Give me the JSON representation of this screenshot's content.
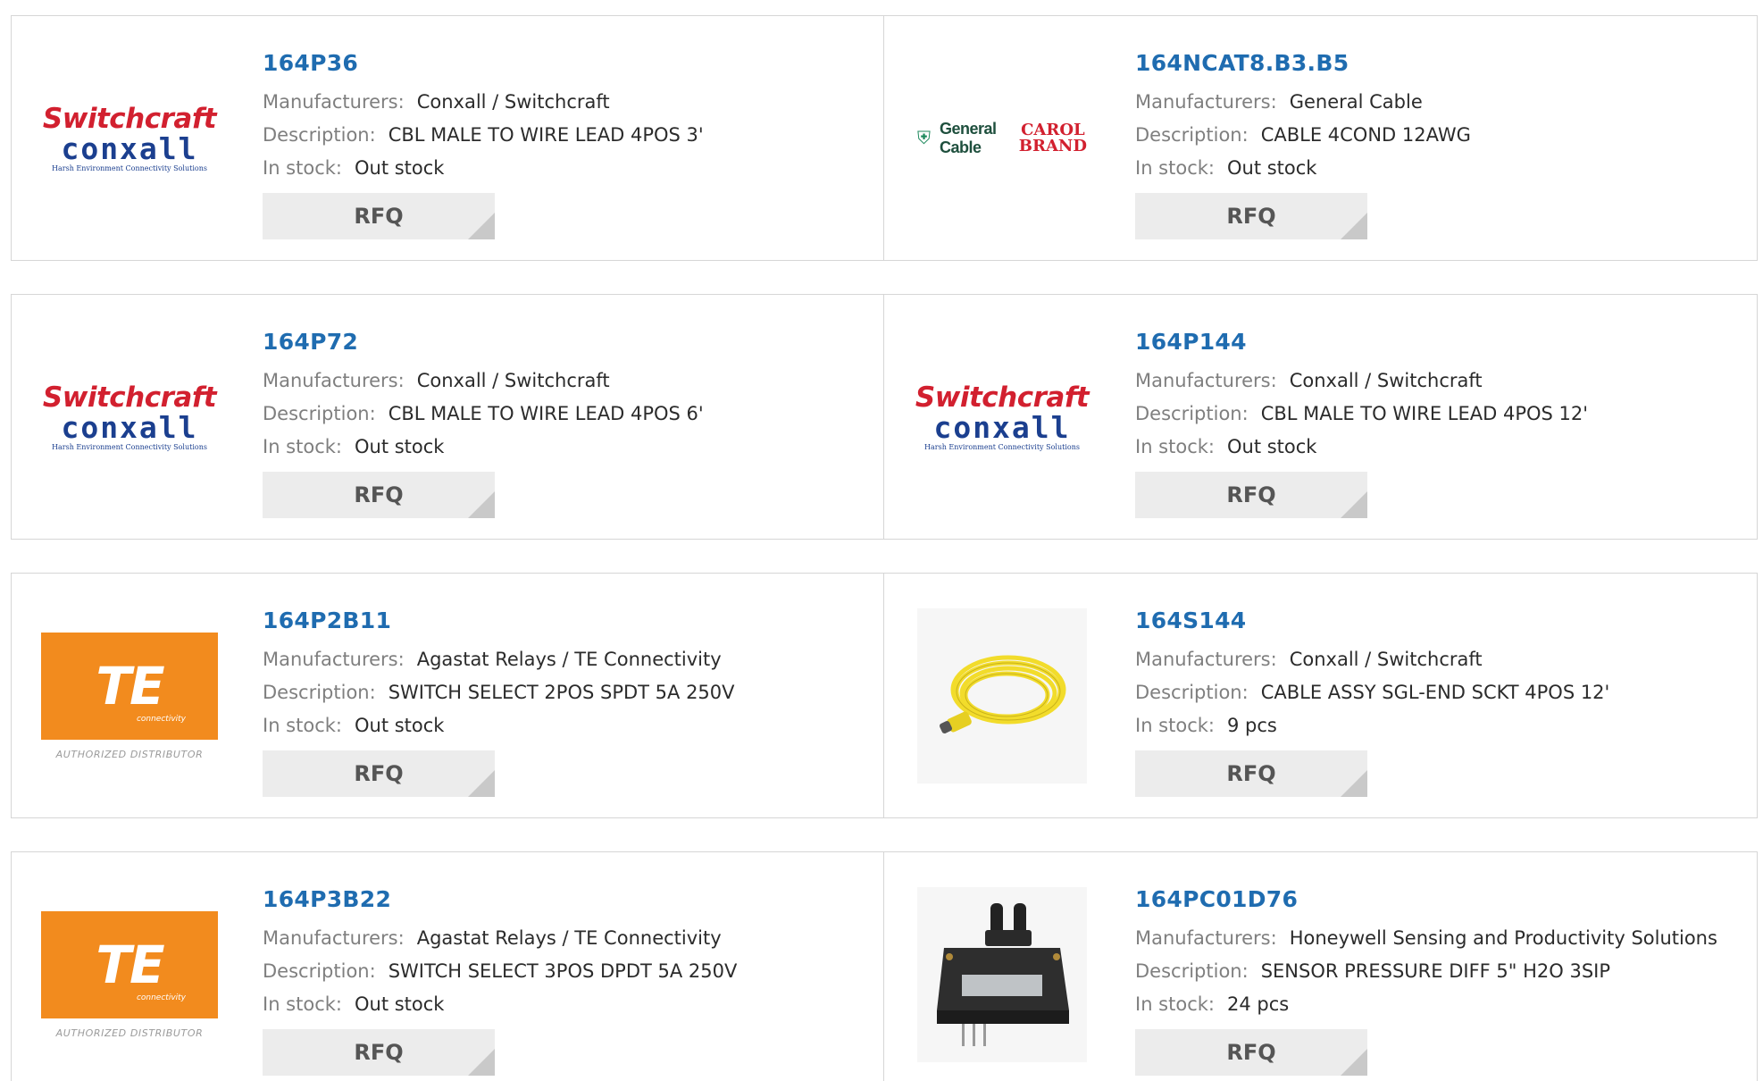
{
  "products": [
    {
      "part_number": "164P36",
      "manufacturer_label": "Manufacturers:",
      "manufacturer": "Conxall / Switchcraft",
      "description_label": "Description:",
      "description": "CBL MALE TO WIRE LEAD 4POS 3'",
      "stock_label": "In stock:",
      "stock": "Out stock",
      "rfq_label": "RFQ",
      "logo": {
        "line1": "Switchcraft",
        "line2": "conxall",
        "line3": "Harsh Environment Connectivity Solutions"
      }
    },
    {
      "part_number": "164NCAT8.B3.B5",
      "manufacturer_label": "Manufacturers:",
      "manufacturer": "General Cable",
      "description_label": "Description:",
      "description": "CABLE 4COND 12AWG",
      "stock_label": "In stock:",
      "stock": "Out stock",
      "rfq_label": "RFQ",
      "logo": {
        "line1": "General Cable",
        "line2": "CAROL",
        "line3": "BRAND"
      }
    },
    {
      "part_number": "164P72",
      "manufacturer_label": "Manufacturers:",
      "manufacturer": "Conxall / Switchcraft",
      "description_label": "Description:",
      "description": "CBL MALE TO WIRE LEAD 4POS 6'",
      "stock_label": "In stock:",
      "stock": "Out stock",
      "rfq_label": "RFQ",
      "logo": {
        "line1": "Switchcraft",
        "line2": "conxall",
        "line3": "Harsh Environment Connectivity Solutions"
      }
    },
    {
      "part_number": "164P144",
      "manufacturer_label": "Manufacturers:",
      "manufacturer": "Conxall / Switchcraft",
      "description_label": "Description:",
      "description": "CBL MALE TO WIRE LEAD 4POS 12'",
      "stock_label": "In stock:",
      "stock": "Out stock",
      "rfq_label": "RFQ",
      "logo": {
        "line1": "Switchcraft",
        "line2": "conxall",
        "line3": "Harsh Environment Connectivity Solutions"
      }
    },
    {
      "part_number": "164P2B11",
      "manufacturer_label": "Manufacturers:",
      "manufacturer": "Agastat Relays / TE Connectivity",
      "description_label": "Description:",
      "description": "SWITCH SELECT 2POS SPDT 5A 250V",
      "stock_label": "In stock:",
      "stock": "Out stock",
      "rfq_label": "RFQ",
      "logo": {
        "line1": "TE",
        "line2": "connectivity",
        "line3": "AUTHORIZED DISTRIBUTOR"
      }
    },
    {
      "part_number": "164S144",
      "manufacturer_label": "Manufacturers:",
      "manufacturer": "Conxall / Switchcraft",
      "description_label": "Description:",
      "description": "CABLE ASSY SGL-END SCKT 4POS 12'",
      "stock_label": "In stock:",
      "stock": "9 pcs",
      "rfq_label": "RFQ",
      "logo": {
        "line1": "",
        "line2": "",
        "line3": ""
      }
    },
    {
      "part_number": "164P3B22",
      "manufacturer_label": "Manufacturers:",
      "manufacturer": "Agastat Relays / TE Connectivity",
      "description_label": "Description:",
      "description": "SWITCH SELECT 3POS DPDT 5A 250V",
      "stock_label": "In stock:",
      "stock": "Out stock",
      "rfq_label": "RFQ",
      "logo": {
        "line1": "TE",
        "line2": "connectivity",
        "line3": "AUTHORIZED DISTRIBUTOR"
      }
    },
    {
      "part_number": "164PC01D76",
      "manufacturer_label": "Manufacturers:",
      "manufacturer": "Honeywell Sensing and Productivity Solutions",
      "description_label": "Description:",
      "description": "SENSOR PRESSURE DIFF 5\" H2O 3SIP",
      "stock_label": "In stock:",
      "stock": "24 pcs",
      "rfq_label": "RFQ",
      "logo": {
        "line1": "",
        "line2": "",
        "line3": ""
      }
    }
  ],
  "colors": {
    "part_link": "#1f6cb0",
    "label_gray": "#7f7f7f",
    "value_dark": "#2b2b2b",
    "rfq_bg": "#ececec",
    "switchcraft_red": "#d2202f",
    "conxall_blue": "#1b3f8f",
    "te_orange": "#f28b1e",
    "cable_yellow": "#f2dc2b"
  }
}
